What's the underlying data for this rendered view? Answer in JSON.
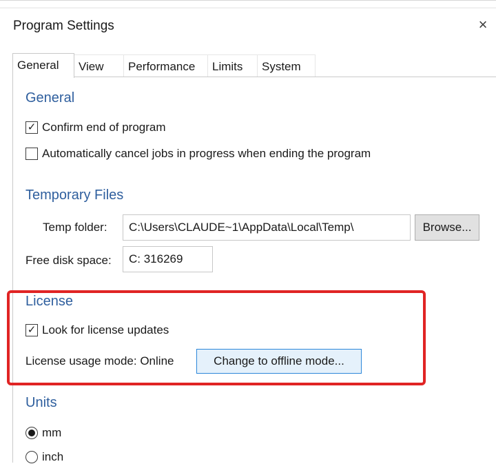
{
  "window": {
    "title": "Program Settings",
    "close_glyph": "×"
  },
  "tabs": [
    {
      "label": "General",
      "active": true
    },
    {
      "label": "View",
      "active": false
    },
    {
      "label": "Performance",
      "active": false
    },
    {
      "label": "Limits",
      "active": false
    },
    {
      "label": "System",
      "active": false
    }
  ],
  "general": {
    "heading": "General",
    "confirm_end": {
      "label": "Confirm end of program",
      "checked": true
    },
    "auto_cancel": {
      "label": "Automatically cancel jobs in progress when ending the program",
      "checked": false
    }
  },
  "temporary_files": {
    "heading": "Temporary Files",
    "temp_folder_label": "Temp folder:",
    "temp_folder_value": "C:\\Users\\CLAUDE~1\\AppData\\Local\\Temp\\",
    "browse_label": "Browse...",
    "free_disk_label": "Free disk space:",
    "free_disk_value": "C: 316269"
  },
  "license": {
    "heading": "License",
    "look_for_updates": {
      "label": "Look for license updates",
      "checked": true
    },
    "usage_mode_text": "License usage mode: Online",
    "change_mode_label": "Change to offline mode..."
  },
  "units": {
    "heading": "Units",
    "options": [
      {
        "label": "mm",
        "selected": true
      },
      {
        "label": "inch",
        "selected": false
      }
    ]
  },
  "colors": {
    "section_heading": "#2f5f9e",
    "highlight": "#e02424",
    "focus_button_border": "#2b86d9"
  },
  "icons": {
    "check": "✓",
    "close": "close-icon"
  }
}
